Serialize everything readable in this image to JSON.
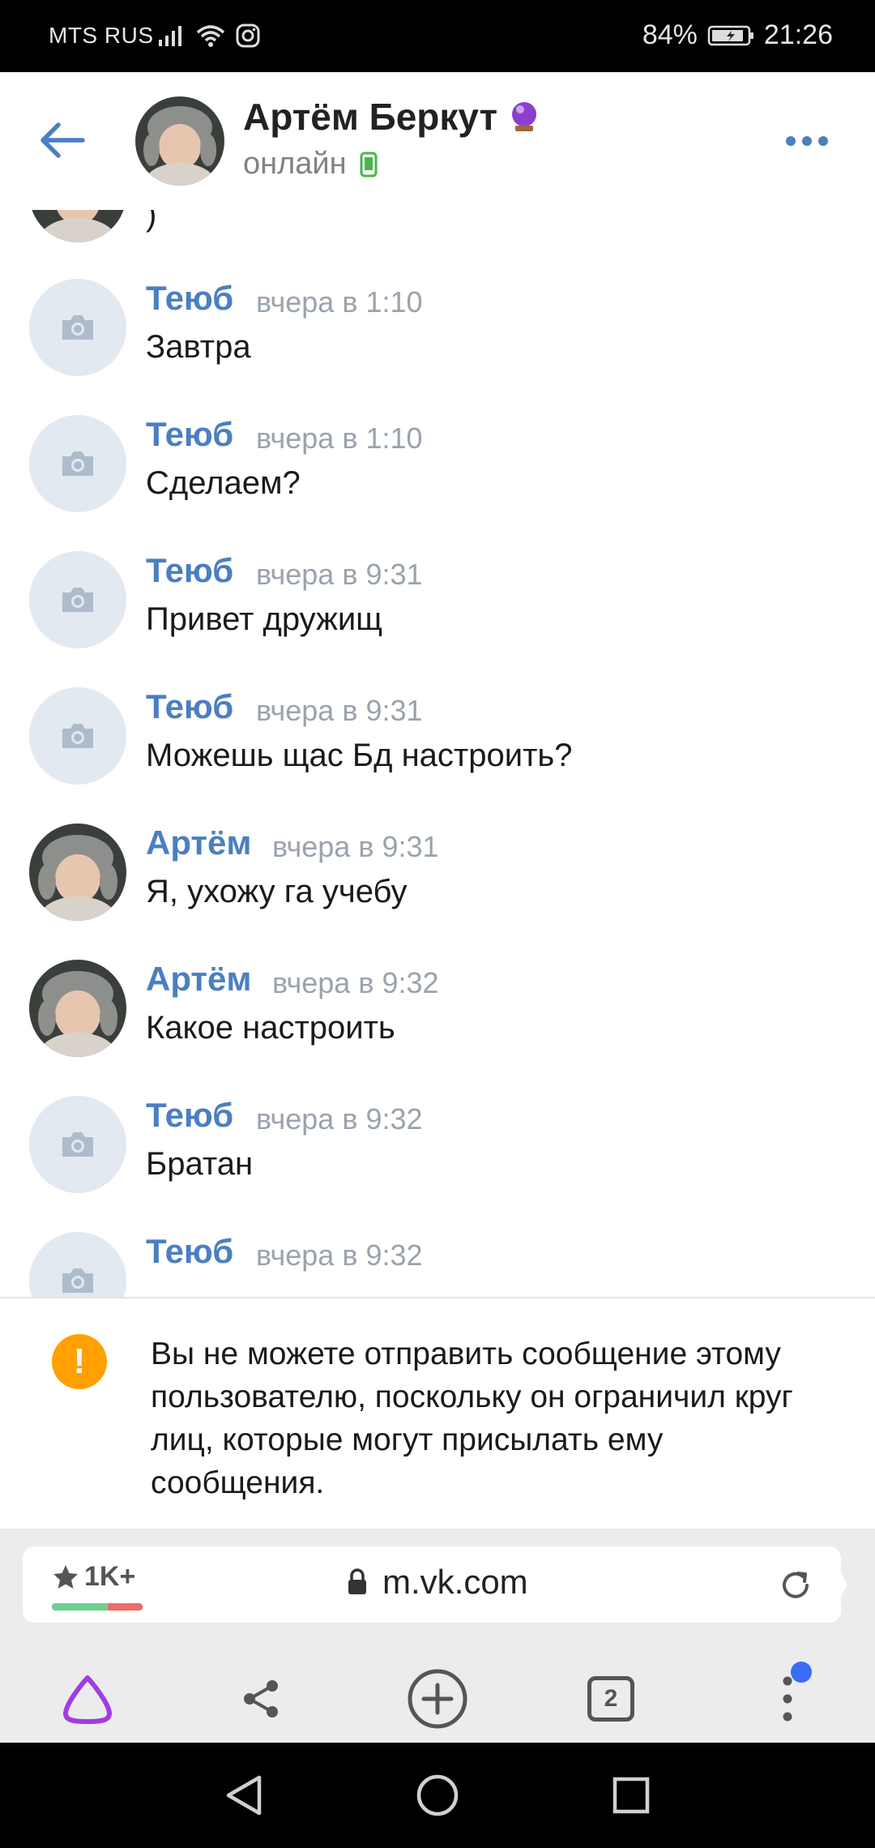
{
  "status_bar": {
    "carrier": "MTS RUS",
    "battery": "84%",
    "time": "21:26"
  },
  "header": {
    "contact_name": "Артём Беркут",
    "contact_status": "онлайн"
  },
  "messages": {
    "top_partial_text": ")",
    "items": [
      {
        "author": "Теюб",
        "time": "вчера в 1:10",
        "text": "Завтра",
        "avatar": "camera-placeholder"
      },
      {
        "author": "Теюб",
        "time": "вчера в 1:10",
        "text": "Сделаем?",
        "avatar": "camera-placeholder"
      },
      {
        "author": "Теюб",
        "time": "вчера в 9:31",
        "text": "Привет дружищ",
        "avatar": "camera-placeholder"
      },
      {
        "author": "Теюб",
        "time": "вчера в 9:31",
        "text": "Можешь щас Бд настроить?",
        "avatar": "camera-placeholder"
      },
      {
        "author": "Артём",
        "time": "вчера в 9:31",
        "text": "Я, ухожу га учебу",
        "avatar": "photo"
      },
      {
        "author": "Артём",
        "time": "вчера в 9:32",
        "text": "Какое настроить",
        "avatar": "photo"
      },
      {
        "author": "Теюб",
        "time": "вчера в 9:32",
        "text": "Братан",
        "avatar": "camera-placeholder"
      },
      {
        "author": "Теюб",
        "time": "вчера в 9:32",
        "text": "",
        "avatar": "camera-placeholder"
      }
    ]
  },
  "notice": {
    "text": "Вы не можете отправить сообщение этому пользователю, поскольку он ограничил круг лиц, которые могут присылать ему сообщения."
  },
  "browser": {
    "rating": "1K+",
    "url": "m.vk.com",
    "tabs_count": "2"
  },
  "colors": {
    "accent": "#4a7fc1",
    "notice": "#ffa000",
    "alice": "#a33ce0"
  }
}
